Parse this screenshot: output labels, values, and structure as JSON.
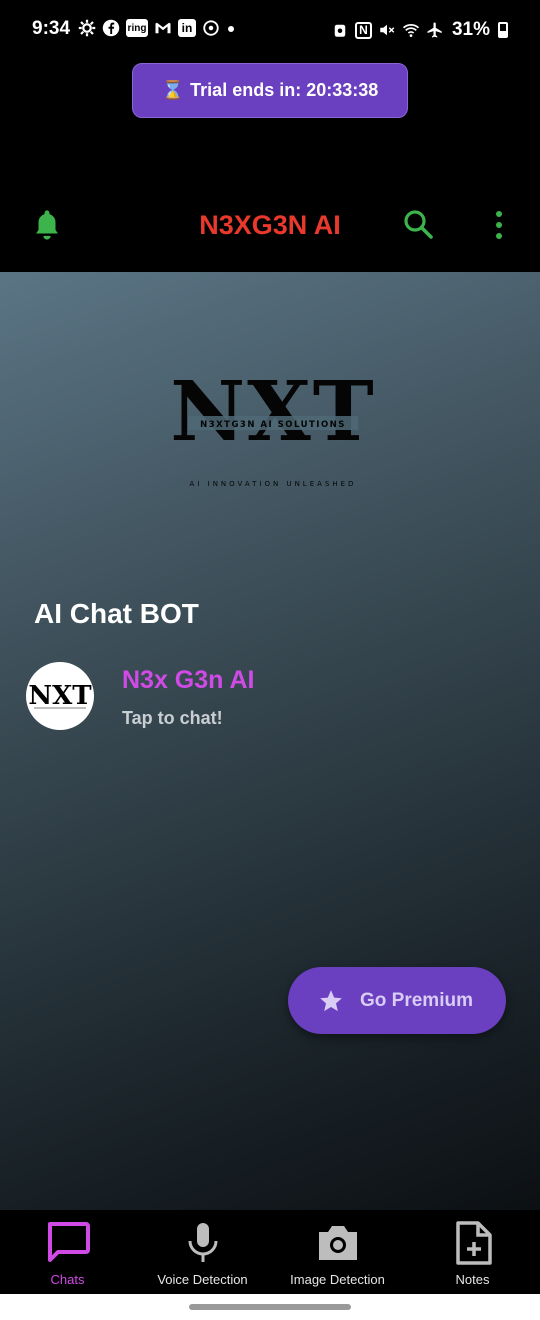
{
  "status_bar": {
    "time": "9:34",
    "battery_percent": "31%",
    "left_icons": [
      "settings-icon",
      "facebook-icon",
      "ring-icon",
      "gmail-icon",
      "linkedin-icon",
      "sync-icon"
    ],
    "left_icon_ring_text": "ring",
    "left_icon_linkedin_text": "in",
    "right_icons": [
      "alarm-icon",
      "nfc-icon",
      "mute-icon",
      "wifi-icon",
      "airplane-icon",
      "battery-icon"
    ],
    "nfc_text": "N"
  },
  "trial": {
    "icon": "hourglass-icon",
    "label": "Trial ends in: 20:33:38"
  },
  "app_bar": {
    "title": "N3XG3N AI",
    "title_color": "#e8392c",
    "icon_color": "#3cb44b"
  },
  "logo": {
    "mark": "NXT",
    "company": "N3XTG3N AI SOLUTIONS",
    "tagline": "AI INNOVATION UNLEASHED"
  },
  "section": {
    "title": "AI Chat BOT"
  },
  "chat": {
    "avatar_text": "NXT",
    "name": "N3x G3n AI",
    "subtitle": "Tap to chat!",
    "name_color": "#d04ae6"
  },
  "premium": {
    "label": "Go Premium",
    "icon": "star-icon",
    "color": "#6a3fc0"
  },
  "bottom_nav": {
    "items": [
      {
        "label": "Chats",
        "icon": "chat-icon",
        "active": true
      },
      {
        "label": "Voice Detection",
        "icon": "microphone-icon",
        "active": false
      },
      {
        "label": "Image Detection",
        "icon": "camera-icon",
        "active": false
      },
      {
        "label": "Notes",
        "icon": "note-add-icon",
        "active": false
      }
    ],
    "active_color": "#d04ae6"
  }
}
